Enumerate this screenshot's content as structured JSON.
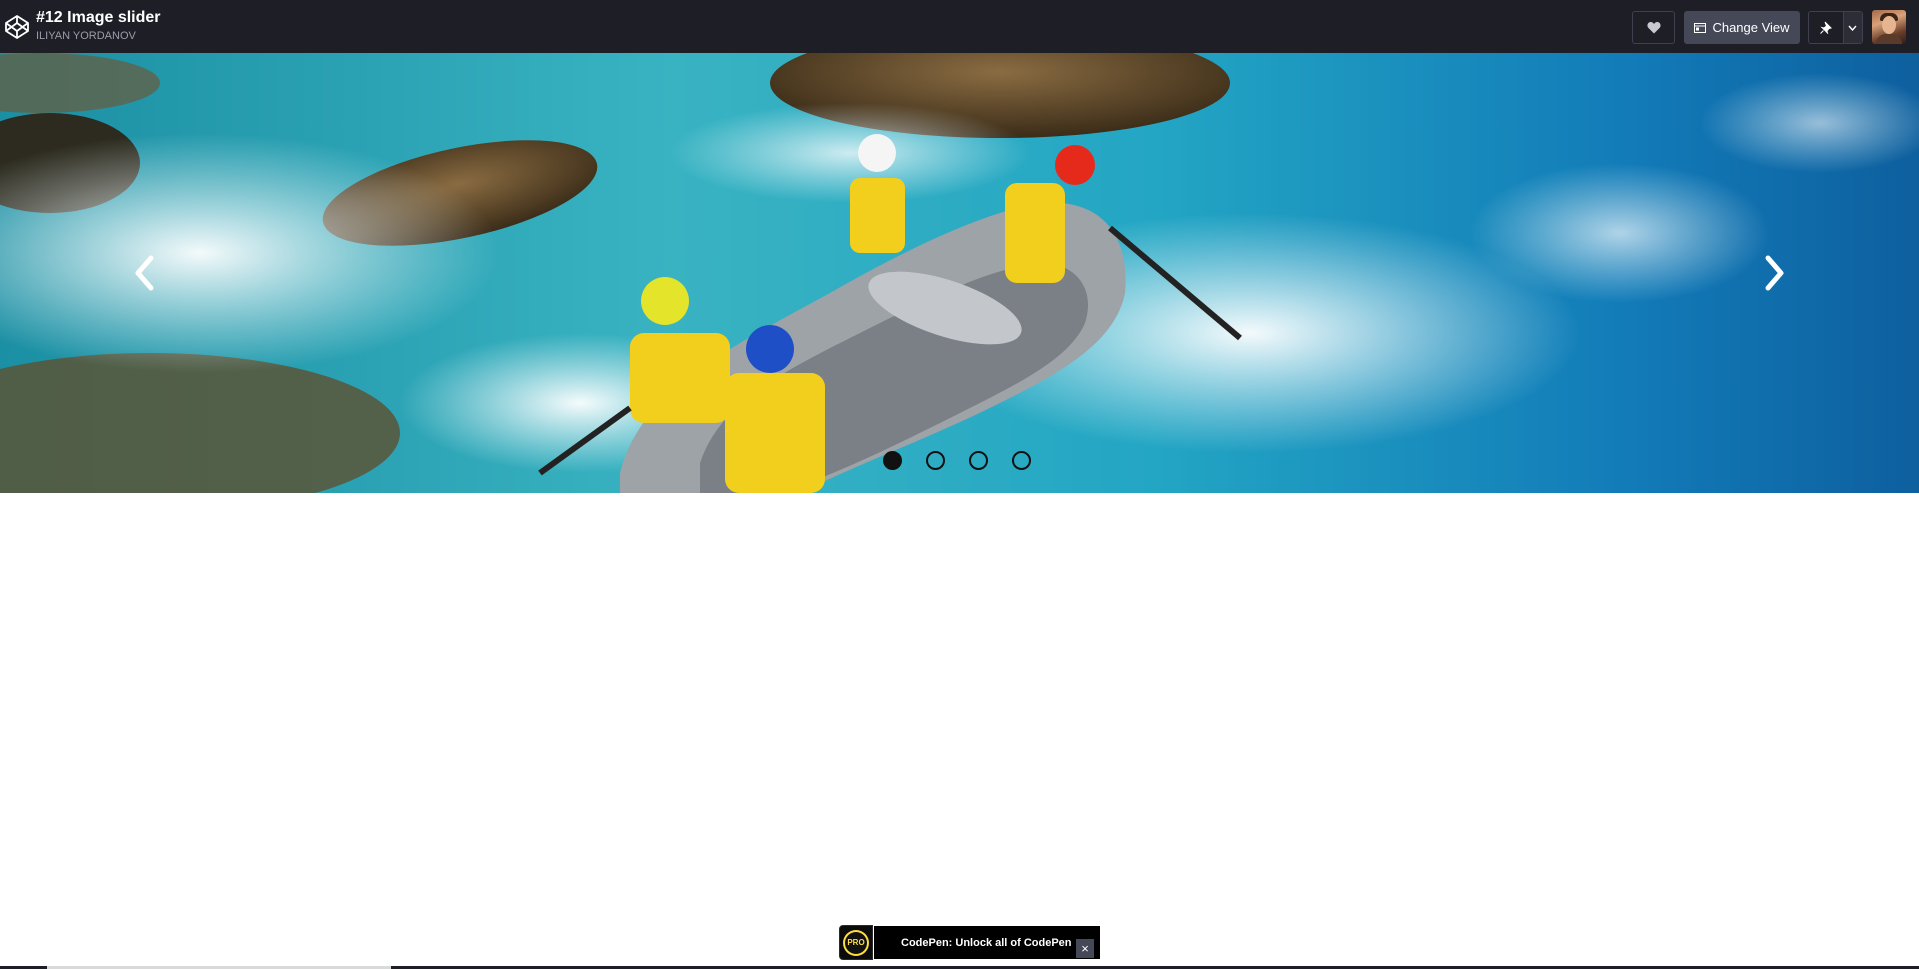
{
  "header": {
    "pen_title": "#12 Image slider",
    "author": "ILIYAN YORDANOV",
    "change_view_label": "Change View",
    "icons": [
      "codepen-logo-icon",
      "heart-icon",
      "layout-icon",
      "pin-icon",
      "chevron-down-icon"
    ]
  },
  "slider": {
    "slide_count": 4,
    "active_index": 0,
    "prev_arrow": "‹",
    "next_arrow": "›",
    "image_description": "whitewater-rafting-photo"
  },
  "pro_banner": {
    "badge": "PRO",
    "label": "CodePen: Unlock all of CodePen",
    "close": "×"
  },
  "colors": {
    "header_bg": "#1e1f26",
    "button_bg": "#444857",
    "pro_yellow": "#ffdd40"
  }
}
